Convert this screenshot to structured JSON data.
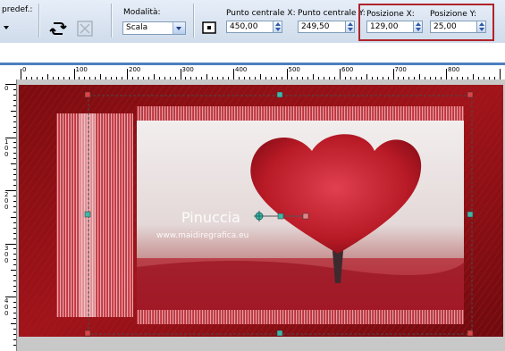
{
  "toolbar": {
    "preset_label": "predef.:",
    "mode_label": "Modalità:",
    "mode_value": "Scala",
    "center_x_label": "Punto centrale X:",
    "center_x_value": "450,00",
    "center_y_label": "Punto centrale Y:",
    "center_y_value": "249,50",
    "pos_x_label": "Posizione X:",
    "pos_x_value": "129,00",
    "pos_y_label": "Posizione Y:",
    "pos_y_value": "25,00"
  },
  "ruler": {
    "h_labels": [
      "0",
      "100",
      "200",
      "300",
      "400",
      "500",
      "600",
      "700",
      "800"
    ],
    "v_labels": [
      "0",
      "1\n0\n0",
      "2\n0\n0",
      "3\n0\n0",
      "4\n0\n0"
    ]
  },
  "canvas": {
    "watermark_title": "Pinuccia",
    "watermark_url": "www.maidiregrafica.eu"
  },
  "colors": {
    "highlight": "#b0242b",
    "background_red": "#8b0f14",
    "handle": "#3fb8a8"
  },
  "icons": [
    "flip-icon",
    "reset-icon",
    "center-icon"
  ]
}
